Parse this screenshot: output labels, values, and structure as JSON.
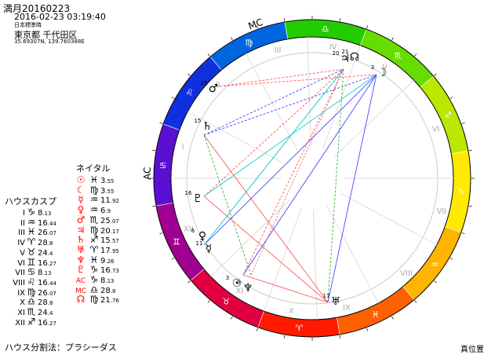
{
  "header": {
    "title": "満月20160223",
    "datetime": "2016-02-23 03:19:40",
    "timezone": "日本標準時",
    "location": "東京都 千代田区",
    "coordinates": "35.69307N, 139.760388E"
  },
  "natal": {
    "title": "ネイタル",
    "planets": [
      {
        "symbol": "☉",
        "color": "#ff0000",
        "sign": "♓",
        "deg": "3",
        "frac": ".55"
      },
      {
        "symbol": "☾",
        "color": "#ff0000",
        "sign": "♍",
        "deg": "3",
        "frac": ".55"
      },
      {
        "symbol": "☿",
        "color": "#ff0000",
        "sign": "♒",
        "deg": "11",
        "frac": ".92"
      },
      {
        "symbol": "♀",
        "color": "#ff0000",
        "sign": "♒",
        "deg": "6",
        "frac": ".9"
      },
      {
        "symbol": "♂",
        "color": "#ff0000",
        "sign": "♏",
        "deg": "25",
        "frac": ".07"
      },
      {
        "symbol": "♃",
        "color": "#ff0000",
        "sign": "♍",
        "deg": "20",
        "frac": ".17"
      },
      {
        "symbol": "♄",
        "color": "#ff0000",
        "sign": "♐",
        "deg": "15",
        "frac": ".57"
      },
      {
        "symbol": "♅",
        "color": "#ff0000",
        "sign": "♈",
        "deg": "17",
        "frac": ".95"
      },
      {
        "symbol": "♆",
        "color": "#ff0000",
        "sign": "♓",
        "deg": "9",
        "frac": ".26"
      },
      {
        "symbol": "♇",
        "color": "#ff0000",
        "sign": "♑",
        "deg": "16",
        "frac": ".73"
      },
      {
        "symbol": "AC",
        "color": "#ff0000",
        "sign": "♑",
        "deg": "8",
        "frac": ".13"
      },
      {
        "symbol": "MC",
        "color": "#ff0000",
        "sign": "♎",
        "deg": "28",
        "frac": ".8"
      },
      {
        "symbol": "☊",
        "color": "#ff0000",
        "sign": "♍",
        "deg": "21",
        "frac": ".76"
      }
    ]
  },
  "houses": {
    "title": "ハウスカスプ",
    "cusps": [
      {
        "num": "I",
        "sign": "♑",
        "deg": "8",
        "frac": ".13"
      },
      {
        "num": "II",
        "sign": "♒",
        "deg": "16",
        "frac": ".44"
      },
      {
        "num": "III",
        "sign": "♓",
        "deg": "26",
        "frac": ".07"
      },
      {
        "num": "IV",
        "sign": "♈",
        "deg": "28",
        "frac": ".8"
      },
      {
        "num": "V",
        "sign": "♉",
        "deg": "24",
        "frac": ".4"
      },
      {
        "num": "VI",
        "sign": "♊",
        "deg": "16",
        "frac": ".27"
      },
      {
        "num": "VII",
        "sign": "♋",
        "deg": "8",
        "frac": ".13"
      },
      {
        "num": "VIII",
        "sign": "♌",
        "deg": "16",
        "frac": ".44"
      },
      {
        "num": "IX",
        "sign": "♍",
        "deg": "26",
        "frac": ".07"
      },
      {
        "num": "X",
        "sign": "♎",
        "deg": "28",
        "frac": ".8"
      },
      {
        "num": "XI",
        "sign": "♏",
        "deg": "24",
        "frac": ".4"
      },
      {
        "num": "XII",
        "sign": "♐",
        "deg": "16",
        "frac": ".27"
      }
    ]
  },
  "wheel": {
    "sign_glyphs": [
      "♈",
      "♉",
      "♊",
      "♋",
      "♌",
      "♍",
      "♎",
      "♏",
      "♐",
      "♑",
      "♒",
      "♓"
    ],
    "house_numerals": [
      "I",
      "II",
      "III",
      "IV",
      "V",
      "VI",
      "VII",
      "VIII",
      "IX",
      "X",
      "XI",
      "XII"
    ],
    "axis_labels": {
      "ac": "AC",
      "mc": "MC"
    },
    "planet_labels": [
      {
        "glyph": "☽",
        "deg": "3"
      },
      {
        "glyph": "♃",
        "deg": "20"
      },
      {
        "glyph": "☊",
        "deg": "21"
      },
      {
        "glyph": "♂",
        "deg": "25"
      },
      {
        "glyph": "♄",
        "deg": "15"
      },
      {
        "glyph": "♇",
        "deg": "16"
      },
      {
        "glyph": "♀",
        "deg": "6"
      },
      {
        "glyph": "☿",
        "deg": "11"
      },
      {
        "glyph": "☉",
        "deg": "3"
      },
      {
        "glyph": "♆",
        "deg": "9"
      },
      {
        "glyph": "♅",
        "deg": "17"
      }
    ]
  },
  "footer": {
    "house_system": "ハウス分割法：プラシーダス",
    "mode": "真位置"
  }
}
